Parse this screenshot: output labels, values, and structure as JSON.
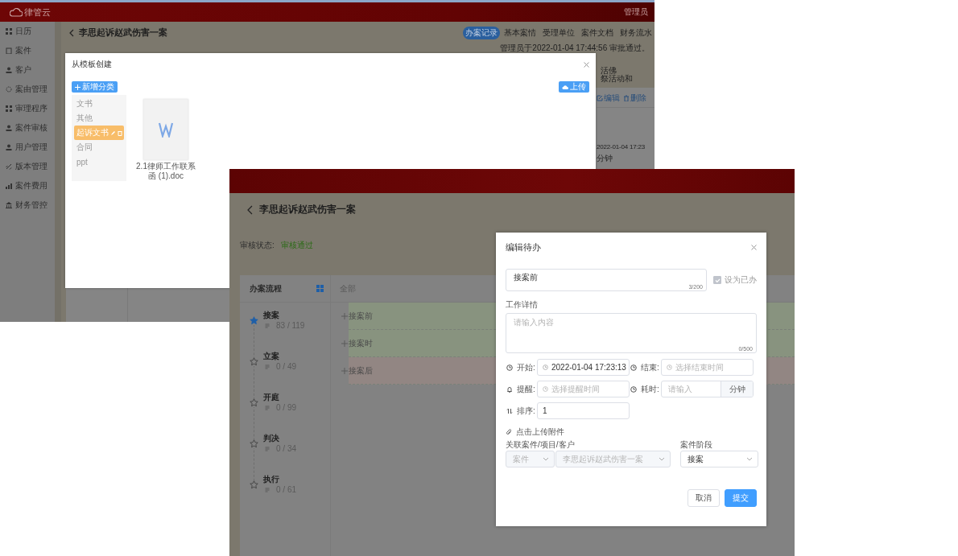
{
  "back_window": {
    "app_name": "律管云",
    "user": "管理员",
    "sidebar": {
      "items": [
        {
          "label": "日历"
        },
        {
          "label": "案件"
        },
        {
          "label": "客户"
        },
        {
          "label": "案由管理"
        },
        {
          "label": "审理程序"
        },
        {
          "label": "案件审核"
        },
        {
          "label": "用户管理"
        },
        {
          "label": "版本管理"
        },
        {
          "label": "案件费用"
        },
        {
          "label": "财务管控"
        }
      ]
    },
    "case_title": "李思起诉赵武伤害一案",
    "tabs": [
      {
        "label": "办案记录",
        "selected": true
      },
      {
        "label": "基本案情",
        "selected": false
      },
      {
        "label": "受理单位",
        "selected": false
      },
      {
        "label": "案件文档",
        "selected": false
      },
      {
        "label": "财务流水",
        "selected": false
      }
    ],
    "approval_note": "管理员于2022-01-04 17:44:56 审批通过。",
    "fragments": [
      "活佛",
      "祭活动和"
    ],
    "actions": [
      "编辑",
      "删除"
    ],
    "detail_values": [
      "2022-01-04 17:23",
      "分钟"
    ],
    "template_dialog": {
      "title": "从模板创建",
      "add_category_button": "新增分类",
      "upload_button": "上传",
      "categories": [
        {
          "label": "文书",
          "selected": false
        },
        {
          "label": "其他",
          "selected": false
        },
        {
          "label": "起诉文书",
          "selected": true
        },
        {
          "label": "合同",
          "selected": false
        },
        {
          "label": "ppt",
          "selected": false
        }
      ],
      "files": [
        {
          "name": "2.1律师工作联系函 (1).doc"
        }
      ]
    }
  },
  "front_window": {
    "case_title": "李思起诉赵武伤害一案",
    "review_label": "审核状态:",
    "review_status": "审核通过",
    "process": {
      "title": "办案流程",
      "filter": "全部",
      "steps": [
        {
          "name": "接案",
          "count": "83 / 119",
          "selected": true
        },
        {
          "name": "立案",
          "count": "0 / 49",
          "selected": false
        },
        {
          "name": "开庭",
          "count": "0 / 99",
          "selected": false
        },
        {
          "name": "判决",
          "count": "0 / 34",
          "selected": false
        },
        {
          "name": "执行",
          "count": "0 / 61",
          "selected": false
        }
      ],
      "tasks": [
        {
          "label": "接案前",
          "color": "#88937f"
        },
        {
          "label": "接案时",
          "color": "#88937f"
        },
        {
          "label": "接案后",
          "color": "#928683"
        }
      ]
    },
    "todo_dialog": {
      "title": "编辑待办",
      "title_field": {
        "value": "接案前",
        "counter": "3/200"
      },
      "done_checkbox": {
        "label": "设为已办",
        "checked": true
      },
      "detail": {
        "label": "工作详情",
        "placeholder": "请输入内容",
        "counter": "0/500"
      },
      "start": {
        "label": "开始:",
        "value": "2022-01-04 17:23:13"
      },
      "end": {
        "label": "结束:",
        "placeholder": "选择结束时间"
      },
      "remind": {
        "label": "提醒:",
        "placeholder": "选择提醒时间"
      },
      "duration": {
        "label": "耗时:",
        "placeholder": "请输入",
        "unit": "分钟"
      },
      "order": {
        "label": "排序:",
        "value": "1"
      },
      "attach_link": "点击上传附件",
      "link_label": "关联案件/项目/客户",
      "link_type": {
        "value": "案件",
        "disabled": true
      },
      "link_target": {
        "value": "李思起诉赵武伤害一案",
        "disabled": true
      },
      "stage_label": "案件阶段",
      "stage": {
        "value": "接案",
        "disabled": false
      },
      "cancel_button": "取消",
      "submit_button": "提交"
    }
  }
}
